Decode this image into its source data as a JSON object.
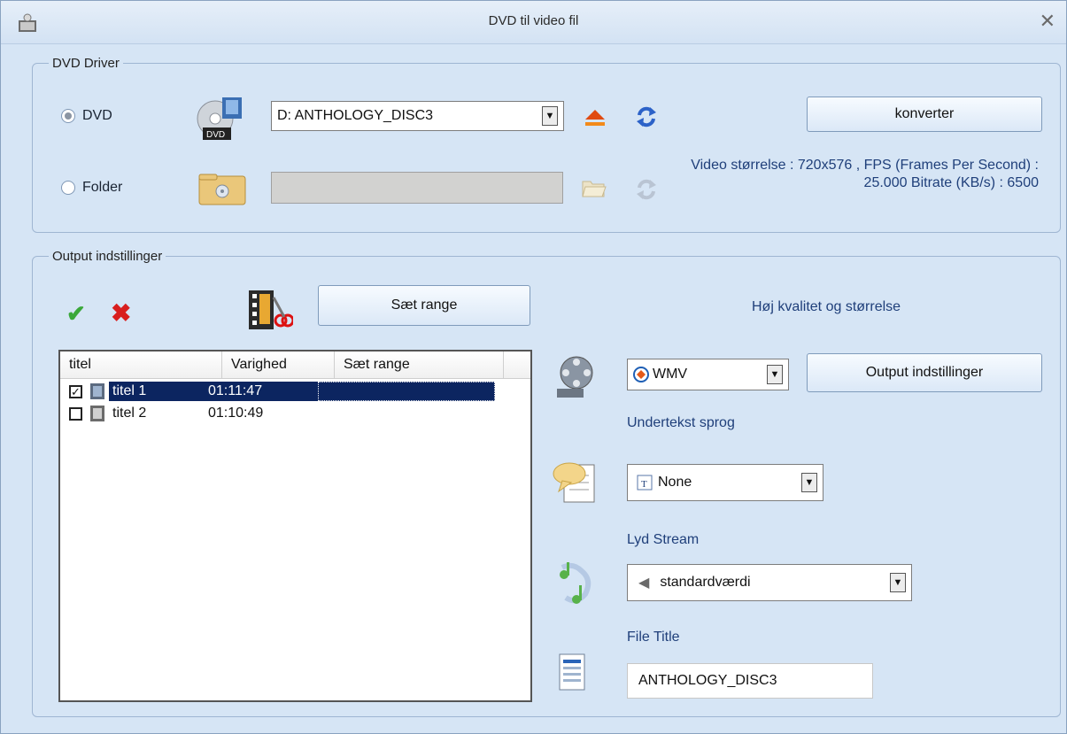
{
  "window": {
    "title": "DVD til video fil"
  },
  "dvd_driver": {
    "legend": "DVD Driver",
    "radio_dvd": "DVD",
    "radio_folder": "Folder",
    "drive_selected": "D:  ANTHOLOGY_DISC3",
    "folder_path": "",
    "convert_label": "konverter",
    "video_info": "Video størrelse : 720x576 , FPS (Frames Per Second) : 25.000 Bitrate (KB/s) : 6500"
  },
  "output": {
    "legend": "Output indstillinger",
    "range_button": "Sæt range",
    "quality_text": "Høj kvalitet  og størrelse",
    "format_selected": "WMV",
    "output_settings_button": "Output indstillinger",
    "subtitle_label": "Undertekst sprog",
    "subtitle_selected": "None",
    "audio_label": "Lyd Stream",
    "audio_selected": "standardværdi",
    "file_title_label": "File Title",
    "file_title_value": "ANTHOLOGY_DISC3"
  },
  "titles_list": {
    "columns": [
      "titel",
      "Varighed",
      "Sæt range"
    ],
    "rows": [
      {
        "name": "titel 1",
        "duration": "01:11:47",
        "checked": true,
        "selected": true
      },
      {
        "name": "titel 2",
        "duration": "01:10:49",
        "checked": false,
        "selected": false
      }
    ]
  }
}
